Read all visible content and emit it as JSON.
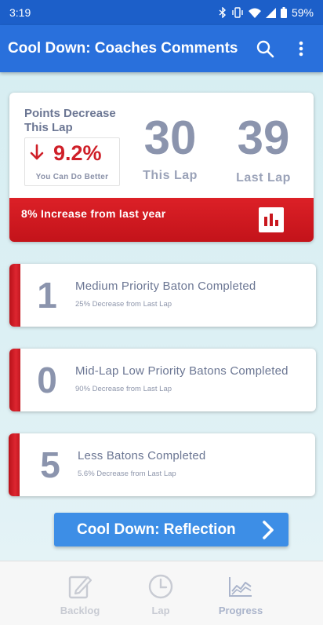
{
  "status_bar": {
    "time": "3:19",
    "battery": "59%",
    "icons": [
      "bluetooth-icon",
      "vibrate-icon",
      "wifi-icon",
      "signal-icon",
      "battery-icon"
    ]
  },
  "app_bar": {
    "title": "Cool Down: Coaches Comments",
    "icons": [
      "search-icon",
      "more-vert-icon"
    ]
  },
  "summary": {
    "title": "Points Decrease This Lap",
    "percent": "9.2%",
    "percent_caption": "You Can Do Better",
    "this_lap_value": "30",
    "this_lap_label": "This Lap",
    "last_lap_value": "39",
    "last_lap_label": "Last Lap",
    "banner_text": "8% Increase from last year"
  },
  "metrics": [
    {
      "value": "1",
      "title": "Medium Priority Baton Completed",
      "subtitle": "25% Decrease from Last Lap"
    },
    {
      "value": "0",
      "title": "Mid-Lap Low Priority Batons Completed",
      "subtitle": "90% Decrease from Last Lap"
    },
    {
      "value": "5",
      "title": "Less Batons Completed",
      "subtitle": "5.6% Decrease from Last Lap"
    }
  ],
  "reflection_button": {
    "label": "Cool Down: Reflection"
  },
  "bottom_nav": {
    "items": [
      {
        "label": "Backlog",
        "icon": "edit-icon"
      },
      {
        "label": "Lap",
        "icon": "clock-icon"
      },
      {
        "label": "Progress",
        "icon": "chart-icon"
      }
    ],
    "active": "Progress"
  },
  "colors": {
    "primary": "#2970dc",
    "status_bar": "#1c5fc9",
    "alert_red": "#cf1f28",
    "button_blue": "#3d8ee6",
    "muted_text": "#8b94ad"
  }
}
